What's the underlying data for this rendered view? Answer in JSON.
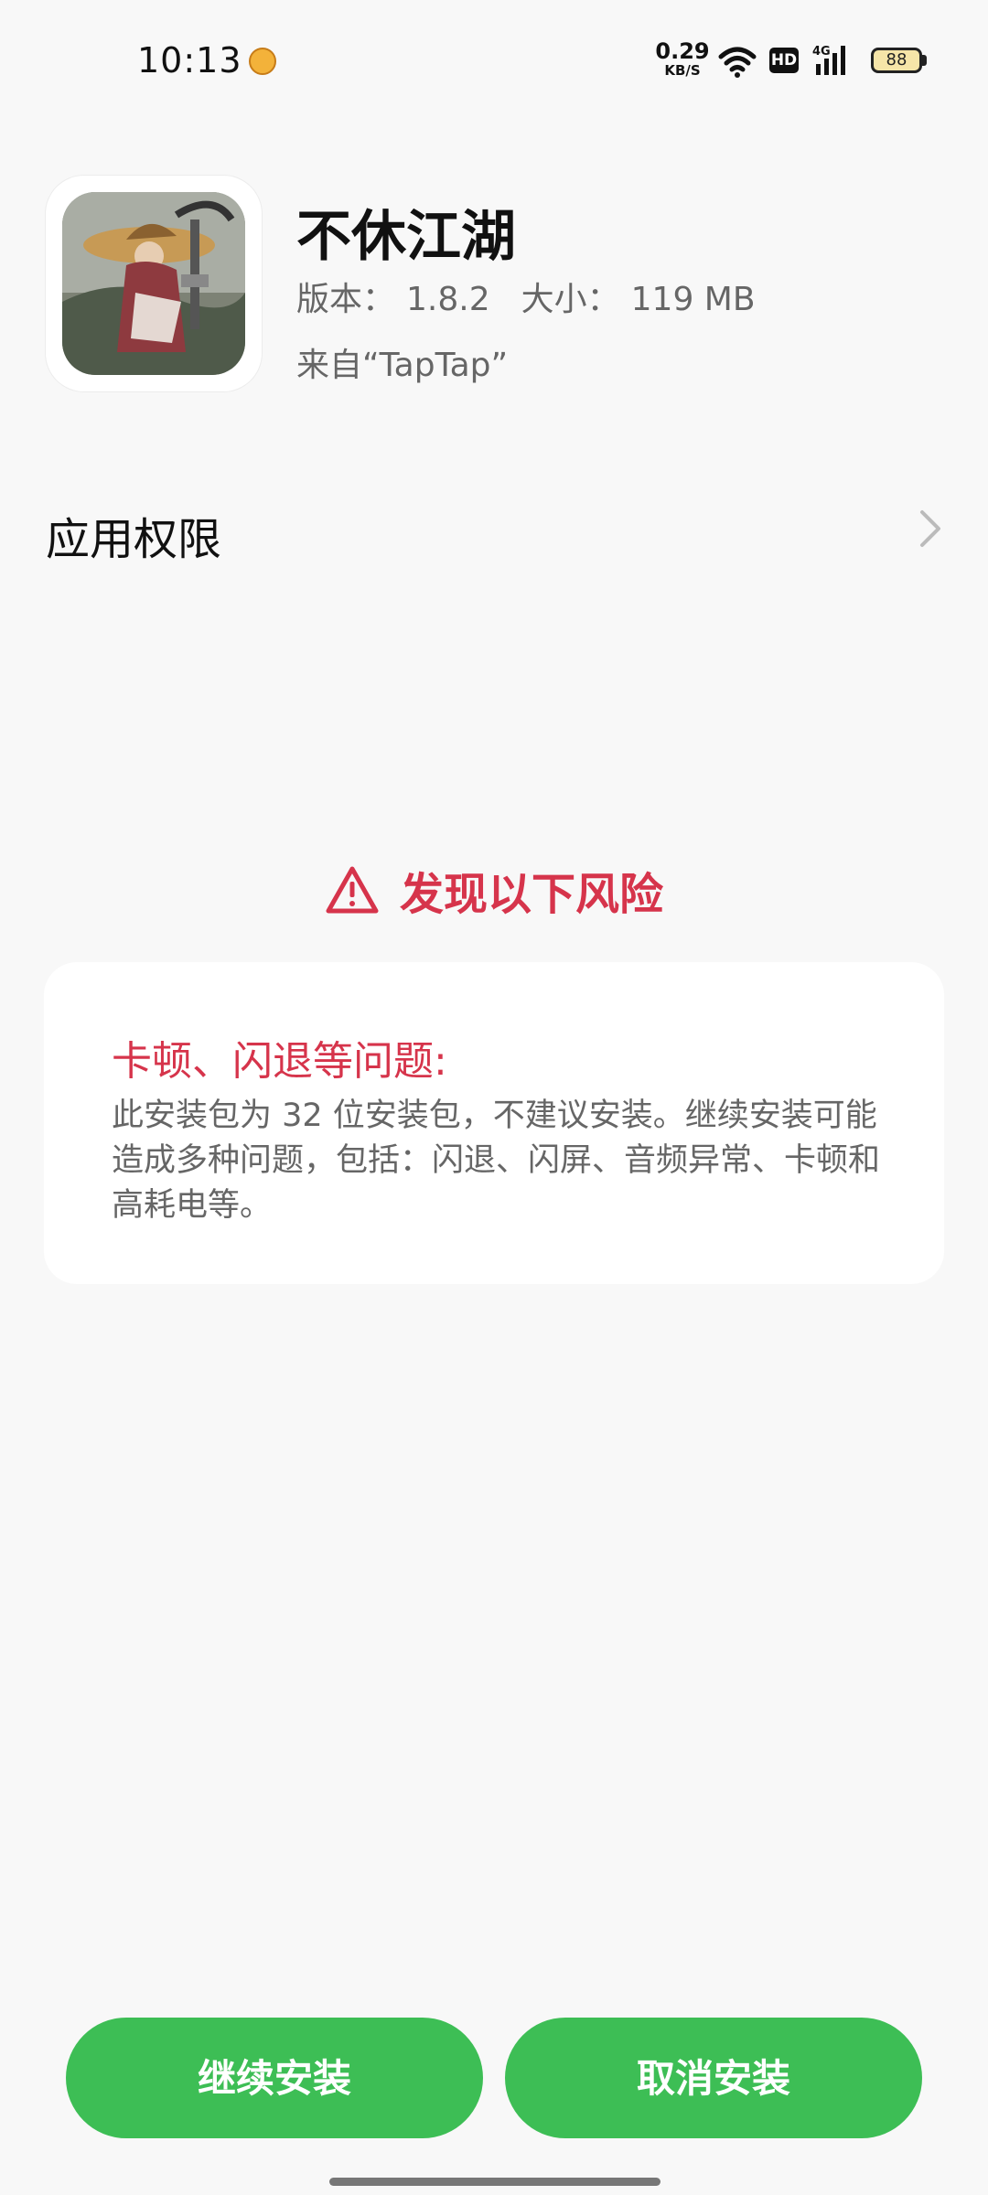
{
  "status_bar": {
    "time": "10:13",
    "net_speed_value": "0.29",
    "net_speed_unit": "KB/S",
    "hd_label": "HD",
    "network_type": "4G",
    "battery": "88",
    "icons": [
      "notification-app-icon",
      "wifi-icon",
      "hd-icon",
      "signal-icon",
      "battery-icon"
    ]
  },
  "app": {
    "name": "不休江湖",
    "version_label": "版本：",
    "version": "1.8.2",
    "size_label": "大小：",
    "size": "119 MB",
    "source": "来自“TapTap”"
  },
  "permissions": {
    "label": "应用权限"
  },
  "risk": {
    "title": "发现以下风险",
    "heading": "卡顿、闪退等问题:",
    "body": "此安装包为 32 位安装包，不建议安装。继续安装可能造成多种问题，包括：闪退、闪屏、音频异常、卡顿和高耗电等。"
  },
  "buttons": {
    "continue": "继续安装",
    "cancel": "取消安装"
  },
  "colors": {
    "accent_red": "#d6344b",
    "button_green": "#3dbe55",
    "background": "#f8f8f8"
  }
}
